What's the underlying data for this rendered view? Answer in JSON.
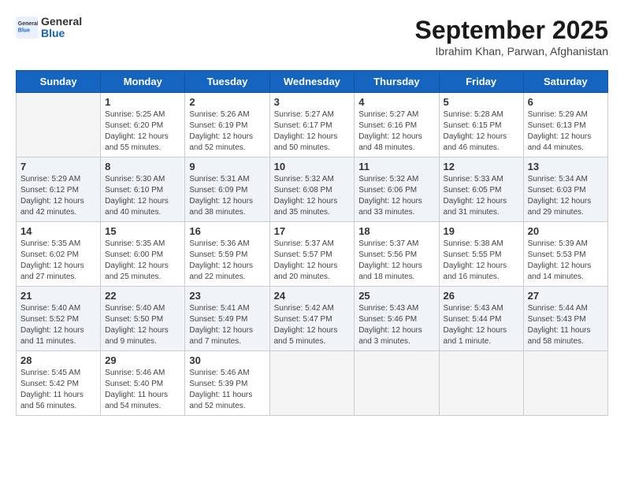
{
  "header": {
    "logo": {
      "general": "General",
      "blue": "Blue"
    },
    "title": "September 2025",
    "subtitle": "Ibrahim Khan, Parwan, Afghanistan"
  },
  "calendar": {
    "days": [
      "Sunday",
      "Monday",
      "Tuesday",
      "Wednesday",
      "Thursday",
      "Friday",
      "Saturday"
    ],
    "weeks": [
      [
        {
          "day": "",
          "info": ""
        },
        {
          "day": "1",
          "info": "Sunrise: 5:25 AM\nSunset: 6:20 PM\nDaylight: 12 hours\nand 55 minutes."
        },
        {
          "day": "2",
          "info": "Sunrise: 5:26 AM\nSunset: 6:19 PM\nDaylight: 12 hours\nand 52 minutes."
        },
        {
          "day": "3",
          "info": "Sunrise: 5:27 AM\nSunset: 6:17 PM\nDaylight: 12 hours\nand 50 minutes."
        },
        {
          "day": "4",
          "info": "Sunrise: 5:27 AM\nSunset: 6:16 PM\nDaylight: 12 hours\nand 48 minutes."
        },
        {
          "day": "5",
          "info": "Sunrise: 5:28 AM\nSunset: 6:15 PM\nDaylight: 12 hours\nand 46 minutes."
        },
        {
          "day": "6",
          "info": "Sunrise: 5:29 AM\nSunset: 6:13 PM\nDaylight: 12 hours\nand 44 minutes."
        }
      ],
      [
        {
          "day": "7",
          "info": "Sunrise: 5:29 AM\nSunset: 6:12 PM\nDaylight: 12 hours\nand 42 minutes."
        },
        {
          "day": "8",
          "info": "Sunrise: 5:30 AM\nSunset: 6:10 PM\nDaylight: 12 hours\nand 40 minutes."
        },
        {
          "day": "9",
          "info": "Sunrise: 5:31 AM\nSunset: 6:09 PM\nDaylight: 12 hours\nand 38 minutes."
        },
        {
          "day": "10",
          "info": "Sunrise: 5:32 AM\nSunset: 6:08 PM\nDaylight: 12 hours\nand 35 minutes."
        },
        {
          "day": "11",
          "info": "Sunrise: 5:32 AM\nSunset: 6:06 PM\nDaylight: 12 hours\nand 33 minutes."
        },
        {
          "day": "12",
          "info": "Sunrise: 5:33 AM\nSunset: 6:05 PM\nDaylight: 12 hours\nand 31 minutes."
        },
        {
          "day": "13",
          "info": "Sunrise: 5:34 AM\nSunset: 6:03 PM\nDaylight: 12 hours\nand 29 minutes."
        }
      ],
      [
        {
          "day": "14",
          "info": "Sunrise: 5:35 AM\nSunset: 6:02 PM\nDaylight: 12 hours\nand 27 minutes."
        },
        {
          "day": "15",
          "info": "Sunrise: 5:35 AM\nSunset: 6:00 PM\nDaylight: 12 hours\nand 25 minutes."
        },
        {
          "day": "16",
          "info": "Sunrise: 5:36 AM\nSunset: 5:59 PM\nDaylight: 12 hours\nand 22 minutes."
        },
        {
          "day": "17",
          "info": "Sunrise: 5:37 AM\nSunset: 5:57 PM\nDaylight: 12 hours\nand 20 minutes."
        },
        {
          "day": "18",
          "info": "Sunrise: 5:37 AM\nSunset: 5:56 PM\nDaylight: 12 hours\nand 18 minutes."
        },
        {
          "day": "19",
          "info": "Sunrise: 5:38 AM\nSunset: 5:55 PM\nDaylight: 12 hours\nand 16 minutes."
        },
        {
          "day": "20",
          "info": "Sunrise: 5:39 AM\nSunset: 5:53 PM\nDaylight: 12 hours\nand 14 minutes."
        }
      ],
      [
        {
          "day": "21",
          "info": "Sunrise: 5:40 AM\nSunset: 5:52 PM\nDaylight: 12 hours\nand 11 minutes."
        },
        {
          "day": "22",
          "info": "Sunrise: 5:40 AM\nSunset: 5:50 PM\nDaylight: 12 hours\nand 9 minutes."
        },
        {
          "day": "23",
          "info": "Sunrise: 5:41 AM\nSunset: 5:49 PM\nDaylight: 12 hours\nand 7 minutes."
        },
        {
          "day": "24",
          "info": "Sunrise: 5:42 AM\nSunset: 5:47 PM\nDaylight: 12 hours\nand 5 minutes."
        },
        {
          "day": "25",
          "info": "Sunrise: 5:43 AM\nSunset: 5:46 PM\nDaylight: 12 hours\nand 3 minutes."
        },
        {
          "day": "26",
          "info": "Sunrise: 5:43 AM\nSunset: 5:44 PM\nDaylight: 12 hours\nand 1 minute."
        },
        {
          "day": "27",
          "info": "Sunrise: 5:44 AM\nSunset: 5:43 PM\nDaylight: 11 hours\nand 58 minutes."
        }
      ],
      [
        {
          "day": "28",
          "info": "Sunrise: 5:45 AM\nSunset: 5:42 PM\nDaylight: 11 hours\nand 56 minutes."
        },
        {
          "day": "29",
          "info": "Sunrise: 5:46 AM\nSunset: 5:40 PM\nDaylight: 11 hours\nand 54 minutes."
        },
        {
          "day": "30",
          "info": "Sunrise: 5:46 AM\nSunset: 5:39 PM\nDaylight: 11 hours\nand 52 minutes."
        },
        {
          "day": "",
          "info": ""
        },
        {
          "day": "",
          "info": ""
        },
        {
          "day": "",
          "info": ""
        },
        {
          "day": "",
          "info": ""
        }
      ]
    ]
  }
}
